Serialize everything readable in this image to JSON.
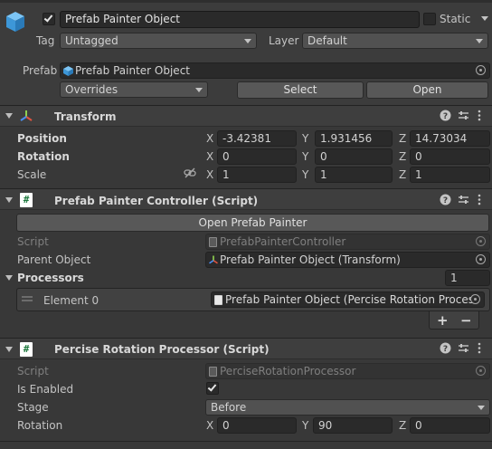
{
  "header": {
    "object_name": "Prefab Painter Object",
    "static_label": "Static",
    "tag_label": "Tag",
    "tag_value": "Untagged",
    "layer_label": "Layer",
    "layer_value": "Default",
    "prefab_label": "Prefab",
    "prefab_value": "Prefab Painter Object",
    "overrides_label": "Overrides",
    "select_label": "Select",
    "open_label": "Open"
  },
  "transform": {
    "title": "Transform",
    "position_label": "Position",
    "rotation_label": "Rotation",
    "scale_label": "Scale",
    "position": {
      "x": "-3.42381",
      "y": "1.931456",
      "z": "14.73034"
    },
    "rotation": {
      "x": "0",
      "y": "0",
      "z": "0"
    },
    "scale": {
      "x": "1",
      "y": "1",
      "z": "1"
    },
    "axis_x": "X",
    "axis_y": "Y",
    "axis_z": "Z"
  },
  "controller": {
    "title": "Prefab Painter Controller (Script)",
    "open_button": "Open Prefab Painter",
    "script_label": "Script",
    "script_value": "PrefabPainterController",
    "parent_label": "Parent Object",
    "parent_value": "Prefab Painter Object (Transform)",
    "processors_label": "Processors",
    "processors_count": "1",
    "element_label": "Element 0",
    "element_value": "Prefab Painter Object (Percise Rotation Process",
    "plus": "+",
    "minus": "−"
  },
  "processor": {
    "title": "Percise Rotation Processor (Script)",
    "script_label": "Script",
    "script_value": "PerciseRotationProcessor",
    "enabled_label": "Is Enabled",
    "stage_label": "Stage",
    "stage_value": "Before",
    "rotation_label": "Rotation",
    "rotation": {
      "x": "0",
      "y": "90",
      "z": "0"
    }
  },
  "icons": {
    "gameobject": "cube-icon",
    "transform": "transform-axes-icon",
    "script": "script-hash-icon",
    "help": "help-icon",
    "presets": "presets-sliders-icon",
    "menu": "kebab-menu-icon",
    "link": "link-icon",
    "target": "object-picker-icon"
  },
  "colors": {
    "background": "#383838",
    "field": "#2a2a2a",
    "button": "#585858",
    "prefab_blue": "#4aa3e0"
  }
}
